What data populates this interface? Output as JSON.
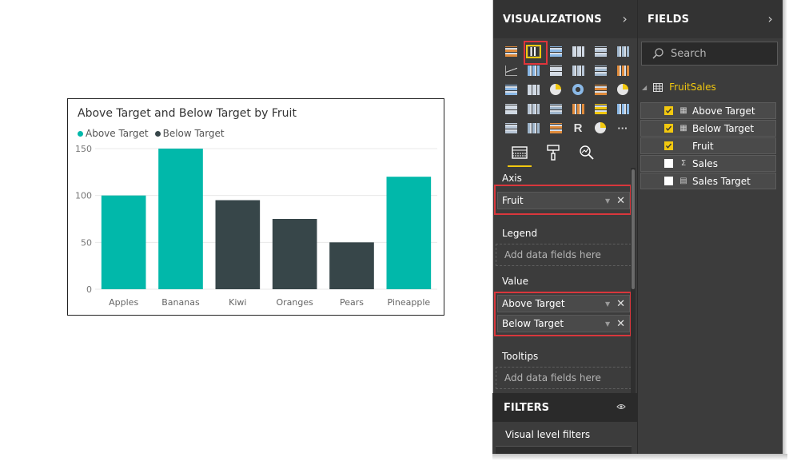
{
  "chart_data": {
    "type": "bar",
    "title": "Above Target and Below Target by Fruit",
    "categories": [
      "Apples",
      "Bananas",
      "Kiwi",
      "Oranges",
      "Pears",
      "Pineapple"
    ],
    "series": [
      {
        "name": "Above Target",
        "color": "#01b8aa",
        "values": [
          100,
          150,
          null,
          null,
          null,
          120
        ]
      },
      {
        "name": "Below Target",
        "color": "#374649",
        "values": [
          null,
          null,
          95,
          75,
          50,
          null
        ]
      }
    ],
    "yticks": [
      0,
      50,
      100,
      150
    ],
    "ylim": [
      0,
      150
    ],
    "grid": true,
    "legend": "top-left"
  },
  "visualizations": {
    "title": "VISUALIZATIONS",
    "chevron": "›",
    "icons": [
      "stacked-bar-chart-icon",
      "stacked-column-chart-icon",
      "clustered-bar-chart-icon",
      "clustered-column-chart-icon",
      "100-stacked-bar-chart-icon",
      "100-stacked-column-chart-icon",
      "line-chart-icon",
      "area-chart-icon",
      "stacked-area-chart-icon",
      "line-clustered-column-icon",
      "line-stacked-column-icon",
      "line-column-chart-icon",
      "ribbon-chart-icon",
      "scatter-chart-icon",
      "pie-chart-icon",
      "donut-chart-icon",
      "treemap-icon",
      "map-icon",
      "filled-map-icon",
      "funnel-icon",
      "gauge-icon",
      "card-icon",
      "multi-row-card-icon",
      "kpi-icon",
      "slicer-icon",
      "table-icon",
      "matrix-icon",
      "r-visual-icon",
      "globe-icon",
      "more-icon"
    ],
    "r_label": "R",
    "more_label": "···",
    "tabs": [
      "fields-tab-icon",
      "format-tab-icon",
      "analytics-tab-icon"
    ],
    "axis_label": "Axis",
    "axis_field": "Fruit",
    "legend_label": "Legend",
    "legend_placeholder": "Add data fields here",
    "value_label": "Value",
    "value_fields": [
      "Above Target",
      "Below Target"
    ],
    "tooltips_label": "Tooltips",
    "tooltips_placeholder": "Add data fields here",
    "filters_title": "FILTERS",
    "visual_filters_label": "Visual level filters"
  },
  "fields": {
    "title": "FIELDS",
    "chevron": "›",
    "search_placeholder": "Search",
    "table_name": "FruitSales",
    "items": [
      {
        "label": "Above Target",
        "checked": true,
        "type": "measure-icon"
      },
      {
        "label": "Below Target",
        "checked": true,
        "type": "measure-icon"
      },
      {
        "label": "Fruit",
        "checked": true,
        "type": ""
      },
      {
        "label": "Sales",
        "checked": false,
        "type": "sigma-icon"
      },
      {
        "label": "Sales Target",
        "checked": false,
        "type": "calculator-icon"
      }
    ],
    "colors": {
      "accent": "#f2c80f",
      "selection": "#e0353b"
    }
  }
}
